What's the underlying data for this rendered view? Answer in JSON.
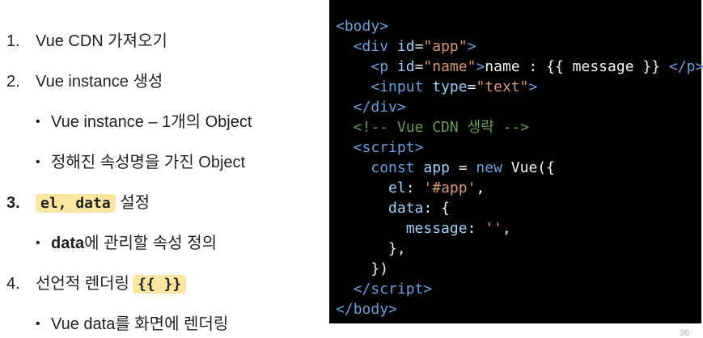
{
  "list": {
    "item1": {
      "num": "1.",
      "text": "Vue CDN 가져오기"
    },
    "item2": {
      "num": "2.",
      "text": "Vue instance 생성"
    },
    "item2_sub1": {
      "bullet": "•",
      "text": "Vue instance – 1개의 Object"
    },
    "item2_sub2": {
      "bullet": "•",
      "text": "정해진 속성명을 가진 Object"
    },
    "item3": {
      "num": "3.",
      "highlight": "el, data",
      "text": "설정"
    },
    "item3_sub1": {
      "bullet": "•",
      "bold": "data",
      "text": "에 관리할 속성 정의"
    },
    "item4": {
      "num": "4.",
      "text": "선언적 렌더링",
      "highlight": "{{ }}"
    },
    "item4_sub1": {
      "bullet": "•",
      "text": "Vue data를 화면에 렌더링"
    }
  },
  "code": {
    "l1": {
      "open": "<",
      "tag": "body",
      "close": ">"
    },
    "l2": {
      "indent": "  ",
      "open": "<",
      "tag": "div",
      "sp": " ",
      "attr": "id",
      "eq": "=",
      "val": "\"app\"",
      "close": ">"
    },
    "l3": {
      "indent": "    ",
      "open": "<",
      "tag": "p",
      "sp": " ",
      "attr": "id",
      "eq": "=",
      "val": "\"name\"",
      "close": ">",
      "text": "name : {{ message }} ",
      "endopen": "</",
      "endtag": "p",
      "endclose": ">"
    },
    "l4": {
      "indent": "    ",
      "open": "<",
      "tag": "input",
      "sp": " ",
      "attr": "type",
      "eq": "=",
      "val": "\"text\"",
      "close": ">"
    },
    "l5": {
      "indent": "  ",
      "open": "</",
      "tag": "div",
      "close": ">"
    },
    "l6": {
      "indent": "  ",
      "comment": "<!-- Vue CDN 생략 -->"
    },
    "l7": {
      "indent": "  ",
      "open": "<",
      "tag": "script",
      "close": ">"
    },
    "l8": {
      "indent": "    ",
      "kw": "const",
      "sp1": " ",
      "var": "app",
      "mid": " = ",
      "kw2": "new",
      "sp2": " ",
      "cls": "Vue",
      "end": "({"
    },
    "l9": {
      "indent": "      ",
      "key": "el",
      "colon": ": ",
      "str": "'#app'",
      "end": ","
    },
    "l10": {
      "indent": "      ",
      "key": "data",
      "end": ": {"
    },
    "l11": {
      "indent": "        ",
      "key": "message",
      "colon": ": ",
      "str": "''",
      "end": ","
    },
    "l12": {
      "indent": "      ",
      "text": "},"
    },
    "l13": {
      "indent": "    ",
      "text": "})"
    },
    "l14": {
      "indent": "  ",
      "open": "</",
      "tag": "script",
      "close": ">"
    },
    "l15": {
      "open": "</",
      "tag": "body",
      "close": ">"
    }
  },
  "page_number": "36",
  "colors": {
    "highlight": "#fbe7a1",
    "code_bg": "#000000",
    "tag": "#6d9ed8",
    "string": "#d79a78",
    "comment": "#6a9955"
  }
}
